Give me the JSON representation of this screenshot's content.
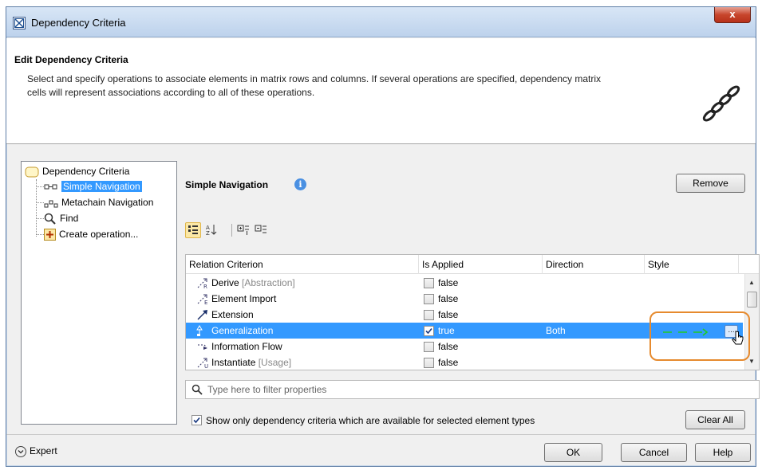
{
  "window": {
    "title": "Dependency Criteria",
    "close_label": "x"
  },
  "header": {
    "title": "Edit Dependency Criteria",
    "description": "Select and specify operations to associate elements in matrix rows and columns. If several operations are specified, dependency matrix cells will represent associations according to all of these operations."
  },
  "tree": {
    "root": "Dependency Criteria",
    "items": [
      {
        "label": "Simple Navigation",
        "selected": true,
        "icon": "simple-navigation-icon"
      },
      {
        "label": "Metachain Navigation",
        "selected": false,
        "icon": "metachain-icon"
      },
      {
        "label": "Find",
        "selected": false,
        "icon": "find-icon"
      },
      {
        "label": "Create operation...",
        "selected": false,
        "icon": "plus-icon"
      }
    ]
  },
  "panel": {
    "title": "Simple Navigation",
    "remove_label": "Remove",
    "columns": [
      "Relation Criterion",
      "Is Applied",
      "Direction",
      "Style"
    ],
    "rows": [
      {
        "name": "Derive",
        "qualifier": "[Abstraction]",
        "applied": false,
        "applied_text": "false",
        "direction": ""
      },
      {
        "name": "Element Import",
        "qualifier": "",
        "applied": false,
        "applied_text": "false",
        "direction": ""
      },
      {
        "name": "Extension",
        "qualifier": "",
        "applied": false,
        "applied_text": "false",
        "direction": ""
      },
      {
        "name": "Generalization",
        "qualifier": "",
        "applied": true,
        "applied_text": "true",
        "direction": "Both",
        "selected": true
      },
      {
        "name": "Information Flow",
        "qualifier": "",
        "applied": false,
        "applied_text": "false",
        "direction": ""
      },
      {
        "name": "Instantiate",
        "qualifier": "[Usage]",
        "applied": false,
        "applied_text": "false",
        "direction": ""
      }
    ],
    "ellipsis_label": "...",
    "filter_placeholder": "Type here to filter properties",
    "show_only_label": "Show only dependency criteria which are available for selected element types",
    "show_only_checked": true,
    "clear_all_label": "Clear All"
  },
  "footer": {
    "expert_label": "Expert",
    "ok_label": "OK",
    "cancel_label": "Cancel",
    "help_label": "Help"
  },
  "colors": {
    "selection": "#3399ff",
    "highlight": "#e68a2e",
    "style_arrow": "#22cc22"
  }
}
